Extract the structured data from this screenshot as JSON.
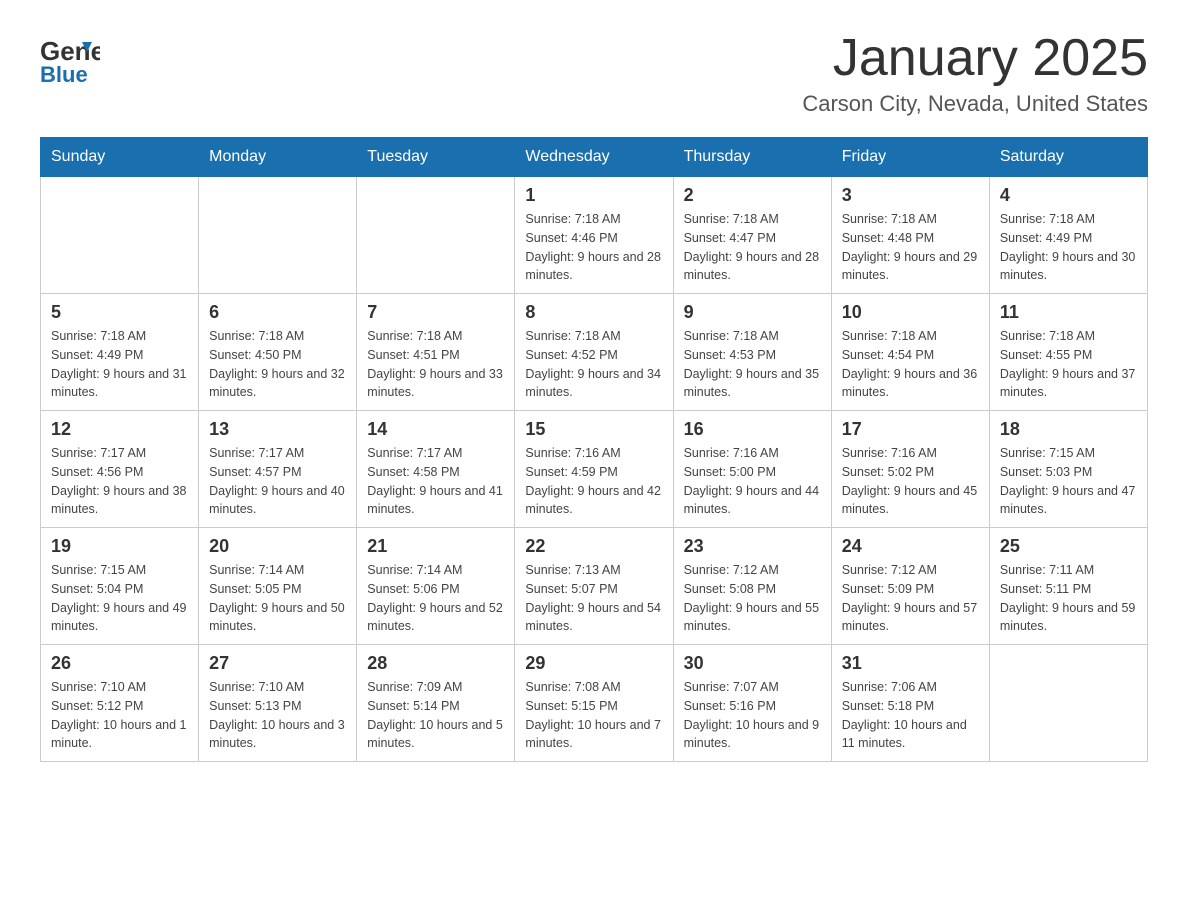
{
  "header": {
    "logo_general": "General",
    "logo_blue": "Blue",
    "month_title": "January 2025",
    "location": "Carson City, Nevada, United States"
  },
  "days_of_week": [
    "Sunday",
    "Monday",
    "Tuesday",
    "Wednesday",
    "Thursday",
    "Friday",
    "Saturday"
  ],
  "weeks": [
    [
      {
        "day": "",
        "info": ""
      },
      {
        "day": "",
        "info": ""
      },
      {
        "day": "",
        "info": ""
      },
      {
        "day": "1",
        "info": "Sunrise: 7:18 AM\nSunset: 4:46 PM\nDaylight: 9 hours\nand 28 minutes."
      },
      {
        "day": "2",
        "info": "Sunrise: 7:18 AM\nSunset: 4:47 PM\nDaylight: 9 hours\nand 28 minutes."
      },
      {
        "day": "3",
        "info": "Sunrise: 7:18 AM\nSunset: 4:48 PM\nDaylight: 9 hours\nand 29 minutes."
      },
      {
        "day": "4",
        "info": "Sunrise: 7:18 AM\nSunset: 4:49 PM\nDaylight: 9 hours\nand 30 minutes."
      }
    ],
    [
      {
        "day": "5",
        "info": "Sunrise: 7:18 AM\nSunset: 4:49 PM\nDaylight: 9 hours\nand 31 minutes."
      },
      {
        "day": "6",
        "info": "Sunrise: 7:18 AM\nSunset: 4:50 PM\nDaylight: 9 hours\nand 32 minutes."
      },
      {
        "day": "7",
        "info": "Sunrise: 7:18 AM\nSunset: 4:51 PM\nDaylight: 9 hours\nand 33 minutes."
      },
      {
        "day": "8",
        "info": "Sunrise: 7:18 AM\nSunset: 4:52 PM\nDaylight: 9 hours\nand 34 minutes."
      },
      {
        "day": "9",
        "info": "Sunrise: 7:18 AM\nSunset: 4:53 PM\nDaylight: 9 hours\nand 35 minutes."
      },
      {
        "day": "10",
        "info": "Sunrise: 7:18 AM\nSunset: 4:54 PM\nDaylight: 9 hours\nand 36 minutes."
      },
      {
        "day": "11",
        "info": "Sunrise: 7:18 AM\nSunset: 4:55 PM\nDaylight: 9 hours\nand 37 minutes."
      }
    ],
    [
      {
        "day": "12",
        "info": "Sunrise: 7:17 AM\nSunset: 4:56 PM\nDaylight: 9 hours\nand 38 minutes."
      },
      {
        "day": "13",
        "info": "Sunrise: 7:17 AM\nSunset: 4:57 PM\nDaylight: 9 hours\nand 40 minutes."
      },
      {
        "day": "14",
        "info": "Sunrise: 7:17 AM\nSunset: 4:58 PM\nDaylight: 9 hours\nand 41 minutes."
      },
      {
        "day": "15",
        "info": "Sunrise: 7:16 AM\nSunset: 4:59 PM\nDaylight: 9 hours\nand 42 minutes."
      },
      {
        "day": "16",
        "info": "Sunrise: 7:16 AM\nSunset: 5:00 PM\nDaylight: 9 hours\nand 44 minutes."
      },
      {
        "day": "17",
        "info": "Sunrise: 7:16 AM\nSunset: 5:02 PM\nDaylight: 9 hours\nand 45 minutes."
      },
      {
        "day": "18",
        "info": "Sunrise: 7:15 AM\nSunset: 5:03 PM\nDaylight: 9 hours\nand 47 minutes."
      }
    ],
    [
      {
        "day": "19",
        "info": "Sunrise: 7:15 AM\nSunset: 5:04 PM\nDaylight: 9 hours\nand 49 minutes."
      },
      {
        "day": "20",
        "info": "Sunrise: 7:14 AM\nSunset: 5:05 PM\nDaylight: 9 hours\nand 50 minutes."
      },
      {
        "day": "21",
        "info": "Sunrise: 7:14 AM\nSunset: 5:06 PM\nDaylight: 9 hours\nand 52 minutes."
      },
      {
        "day": "22",
        "info": "Sunrise: 7:13 AM\nSunset: 5:07 PM\nDaylight: 9 hours\nand 54 minutes."
      },
      {
        "day": "23",
        "info": "Sunrise: 7:12 AM\nSunset: 5:08 PM\nDaylight: 9 hours\nand 55 minutes."
      },
      {
        "day": "24",
        "info": "Sunrise: 7:12 AM\nSunset: 5:09 PM\nDaylight: 9 hours\nand 57 minutes."
      },
      {
        "day": "25",
        "info": "Sunrise: 7:11 AM\nSunset: 5:11 PM\nDaylight: 9 hours\nand 59 minutes."
      }
    ],
    [
      {
        "day": "26",
        "info": "Sunrise: 7:10 AM\nSunset: 5:12 PM\nDaylight: 10 hours\nand 1 minute."
      },
      {
        "day": "27",
        "info": "Sunrise: 7:10 AM\nSunset: 5:13 PM\nDaylight: 10 hours\nand 3 minutes."
      },
      {
        "day": "28",
        "info": "Sunrise: 7:09 AM\nSunset: 5:14 PM\nDaylight: 10 hours\nand 5 minutes."
      },
      {
        "day": "29",
        "info": "Sunrise: 7:08 AM\nSunset: 5:15 PM\nDaylight: 10 hours\nand 7 minutes."
      },
      {
        "day": "30",
        "info": "Sunrise: 7:07 AM\nSunset: 5:16 PM\nDaylight: 10 hours\nand 9 minutes."
      },
      {
        "day": "31",
        "info": "Sunrise: 7:06 AM\nSunset: 5:18 PM\nDaylight: 10 hours\nand 11 minutes."
      },
      {
        "day": "",
        "info": ""
      }
    ]
  ]
}
